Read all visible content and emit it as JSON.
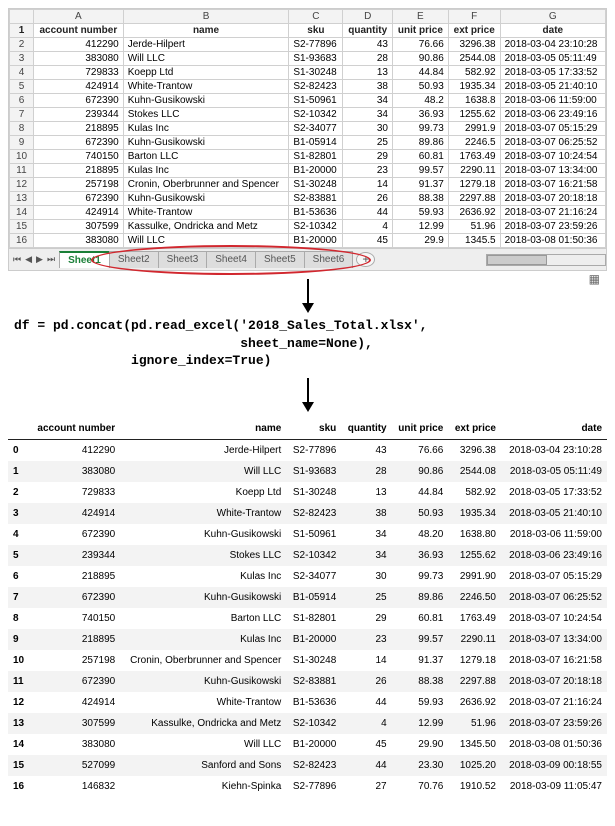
{
  "excel": {
    "col_letters": [
      "A",
      "B",
      "C",
      "D",
      "E",
      "F",
      "G"
    ],
    "headers": [
      "account number",
      "name",
      "sku",
      "quantity",
      "unit price",
      "ext price",
      "date"
    ],
    "rows": [
      {
        "n": 2,
        "acct": "412290",
        "name": "Jerde-Hilpert",
        "sku": "S2-77896",
        "qty": "43",
        "up": "76.66",
        "ext": "3296.38",
        "date": "2018-03-04 23:10:28"
      },
      {
        "n": 3,
        "acct": "383080",
        "name": "Will LLC",
        "sku": "S1-93683",
        "qty": "28",
        "up": "90.86",
        "ext": "2544.08",
        "date": "2018-03-05 05:11:49"
      },
      {
        "n": 4,
        "acct": "729833",
        "name": "Koepp Ltd",
        "sku": "S1-30248",
        "qty": "13",
        "up": "44.84",
        "ext": "582.92",
        "date": "2018-03-05 17:33:52"
      },
      {
        "n": 5,
        "acct": "424914",
        "name": "White-Trantow",
        "sku": "S2-82423",
        "qty": "38",
        "up": "50.93",
        "ext": "1935.34",
        "date": "2018-03-05 21:40:10"
      },
      {
        "n": 6,
        "acct": "672390",
        "name": "Kuhn-Gusikowski",
        "sku": "S1-50961",
        "qty": "34",
        "up": "48.2",
        "ext": "1638.8",
        "date": "2018-03-06 11:59:00"
      },
      {
        "n": 7,
        "acct": "239344",
        "name": "Stokes LLC",
        "sku": "S2-10342",
        "qty": "34",
        "up": "36.93",
        "ext": "1255.62",
        "date": "2018-03-06 23:49:16"
      },
      {
        "n": 8,
        "acct": "218895",
        "name": "Kulas Inc",
        "sku": "S2-34077",
        "qty": "30",
        "up": "99.73",
        "ext": "2991.9",
        "date": "2018-03-07 05:15:29"
      },
      {
        "n": 9,
        "acct": "672390",
        "name": "Kuhn-Gusikowski",
        "sku": "B1-05914",
        "qty": "25",
        "up": "89.86",
        "ext": "2246.5",
        "date": "2018-03-07 06:25:52"
      },
      {
        "n": 10,
        "acct": "740150",
        "name": "Barton LLC",
        "sku": "S1-82801",
        "qty": "29",
        "up": "60.81",
        "ext": "1763.49",
        "date": "2018-03-07 10:24:54"
      },
      {
        "n": 11,
        "acct": "218895",
        "name": "Kulas Inc",
        "sku": "B1-20000",
        "qty": "23",
        "up": "99.57",
        "ext": "2290.11",
        "date": "2018-03-07 13:34:00"
      },
      {
        "n": 12,
        "acct": "257198",
        "name": "Cronin, Oberbrunner and Spencer",
        "sku": "S1-30248",
        "qty": "14",
        "up": "91.37",
        "ext": "1279.18",
        "date": "2018-03-07 16:21:58"
      },
      {
        "n": 13,
        "acct": "672390",
        "name": "Kuhn-Gusikowski",
        "sku": "S2-83881",
        "qty": "26",
        "up": "88.38",
        "ext": "2297.88",
        "date": "2018-03-07 20:18:18"
      },
      {
        "n": 14,
        "acct": "424914",
        "name": "White-Trantow",
        "sku": "B1-53636",
        "qty": "44",
        "up": "59.93",
        "ext": "2636.92",
        "date": "2018-03-07 21:16:24"
      },
      {
        "n": 15,
        "acct": "307599",
        "name": "Kassulke, Ondricka and Metz",
        "sku": "S2-10342",
        "qty": "4",
        "up": "12.99",
        "ext": "51.96",
        "date": "2018-03-07 23:59:26"
      },
      {
        "n": 16,
        "acct": "383080",
        "name": "Will LLC",
        "sku": "B1-20000",
        "qty": "45",
        "up": "29.9",
        "ext": "1345.5",
        "date": "2018-03-08 01:50:36"
      }
    ],
    "tabs": [
      "Sheet1",
      "Sheet2",
      "Sheet3",
      "Sheet4",
      "Sheet5",
      "Sheet6"
    ],
    "active_tab": 0
  },
  "code": {
    "line1": "df = pd.concat(pd.read_excel('2018_Sales_Total.xlsx',",
    "line2": "                             sheet_name=None),",
    "line3": "               ignore_index=True)"
  },
  "df": {
    "headers": [
      "",
      "account number",
      "name",
      "sku",
      "quantity",
      "unit price",
      "ext price",
      "date"
    ],
    "rows": [
      {
        "i": "0",
        "acct": "412290",
        "name": "Jerde-Hilpert",
        "sku": "S2-77896",
        "qty": "43",
        "up": "76.66",
        "ext": "3296.38",
        "date": "2018-03-04 23:10:28"
      },
      {
        "i": "1",
        "acct": "383080",
        "name": "Will LLC",
        "sku": "S1-93683",
        "qty": "28",
        "up": "90.86",
        "ext": "2544.08",
        "date": "2018-03-05 05:11:49"
      },
      {
        "i": "2",
        "acct": "729833",
        "name": "Koepp Ltd",
        "sku": "S1-30248",
        "qty": "13",
        "up": "44.84",
        "ext": "582.92",
        "date": "2018-03-05 17:33:52"
      },
      {
        "i": "3",
        "acct": "424914",
        "name": "White-Trantow",
        "sku": "S2-82423",
        "qty": "38",
        "up": "50.93",
        "ext": "1935.34",
        "date": "2018-03-05 21:40:10"
      },
      {
        "i": "4",
        "acct": "672390",
        "name": "Kuhn-Gusikowski",
        "sku": "S1-50961",
        "qty": "34",
        "up": "48.20",
        "ext": "1638.80",
        "date": "2018-03-06 11:59:00"
      },
      {
        "i": "5",
        "acct": "239344",
        "name": "Stokes LLC",
        "sku": "S2-10342",
        "qty": "34",
        "up": "36.93",
        "ext": "1255.62",
        "date": "2018-03-06 23:49:16"
      },
      {
        "i": "6",
        "acct": "218895",
        "name": "Kulas Inc",
        "sku": "S2-34077",
        "qty": "30",
        "up": "99.73",
        "ext": "2991.90",
        "date": "2018-03-07 05:15:29"
      },
      {
        "i": "7",
        "acct": "672390",
        "name": "Kuhn-Gusikowski",
        "sku": "B1-05914",
        "qty": "25",
        "up": "89.86",
        "ext": "2246.50",
        "date": "2018-03-07 06:25:52"
      },
      {
        "i": "8",
        "acct": "740150",
        "name": "Barton LLC",
        "sku": "S1-82801",
        "qty": "29",
        "up": "60.81",
        "ext": "1763.49",
        "date": "2018-03-07 10:24:54"
      },
      {
        "i": "9",
        "acct": "218895",
        "name": "Kulas Inc",
        "sku": "B1-20000",
        "qty": "23",
        "up": "99.57",
        "ext": "2290.11",
        "date": "2018-03-07 13:34:00"
      },
      {
        "i": "10",
        "acct": "257198",
        "name": "Cronin, Oberbrunner and Spencer",
        "sku": "S1-30248",
        "qty": "14",
        "up": "91.37",
        "ext": "1279.18",
        "date": "2018-03-07 16:21:58"
      },
      {
        "i": "11",
        "acct": "672390",
        "name": "Kuhn-Gusikowski",
        "sku": "S2-83881",
        "qty": "26",
        "up": "88.38",
        "ext": "2297.88",
        "date": "2018-03-07 20:18:18"
      },
      {
        "i": "12",
        "acct": "424914",
        "name": "White-Trantow",
        "sku": "B1-53636",
        "qty": "44",
        "up": "59.93",
        "ext": "2636.92",
        "date": "2018-03-07 21:16:24"
      },
      {
        "i": "13",
        "acct": "307599",
        "name": "Kassulke, Ondricka and Metz",
        "sku": "S2-10342",
        "qty": "4",
        "up": "12.99",
        "ext": "51.96",
        "date": "2018-03-07 23:59:26"
      },
      {
        "i": "14",
        "acct": "383080",
        "name": "Will LLC",
        "sku": "B1-20000",
        "qty": "45",
        "up": "29.90",
        "ext": "1345.50",
        "date": "2018-03-08 01:50:36"
      },
      {
        "i": "15",
        "acct": "527099",
        "name": "Sanford and Sons",
        "sku": "S2-82423",
        "qty": "44",
        "up": "23.30",
        "ext": "1025.20",
        "date": "2018-03-09 00:18:55"
      },
      {
        "i": "16",
        "acct": "146832",
        "name": "Kiehn-Spinka",
        "sku": "S2-77896",
        "qty": "27",
        "up": "70.76",
        "ext": "1910.52",
        "date": "2018-03-09 11:05:47"
      }
    ]
  }
}
